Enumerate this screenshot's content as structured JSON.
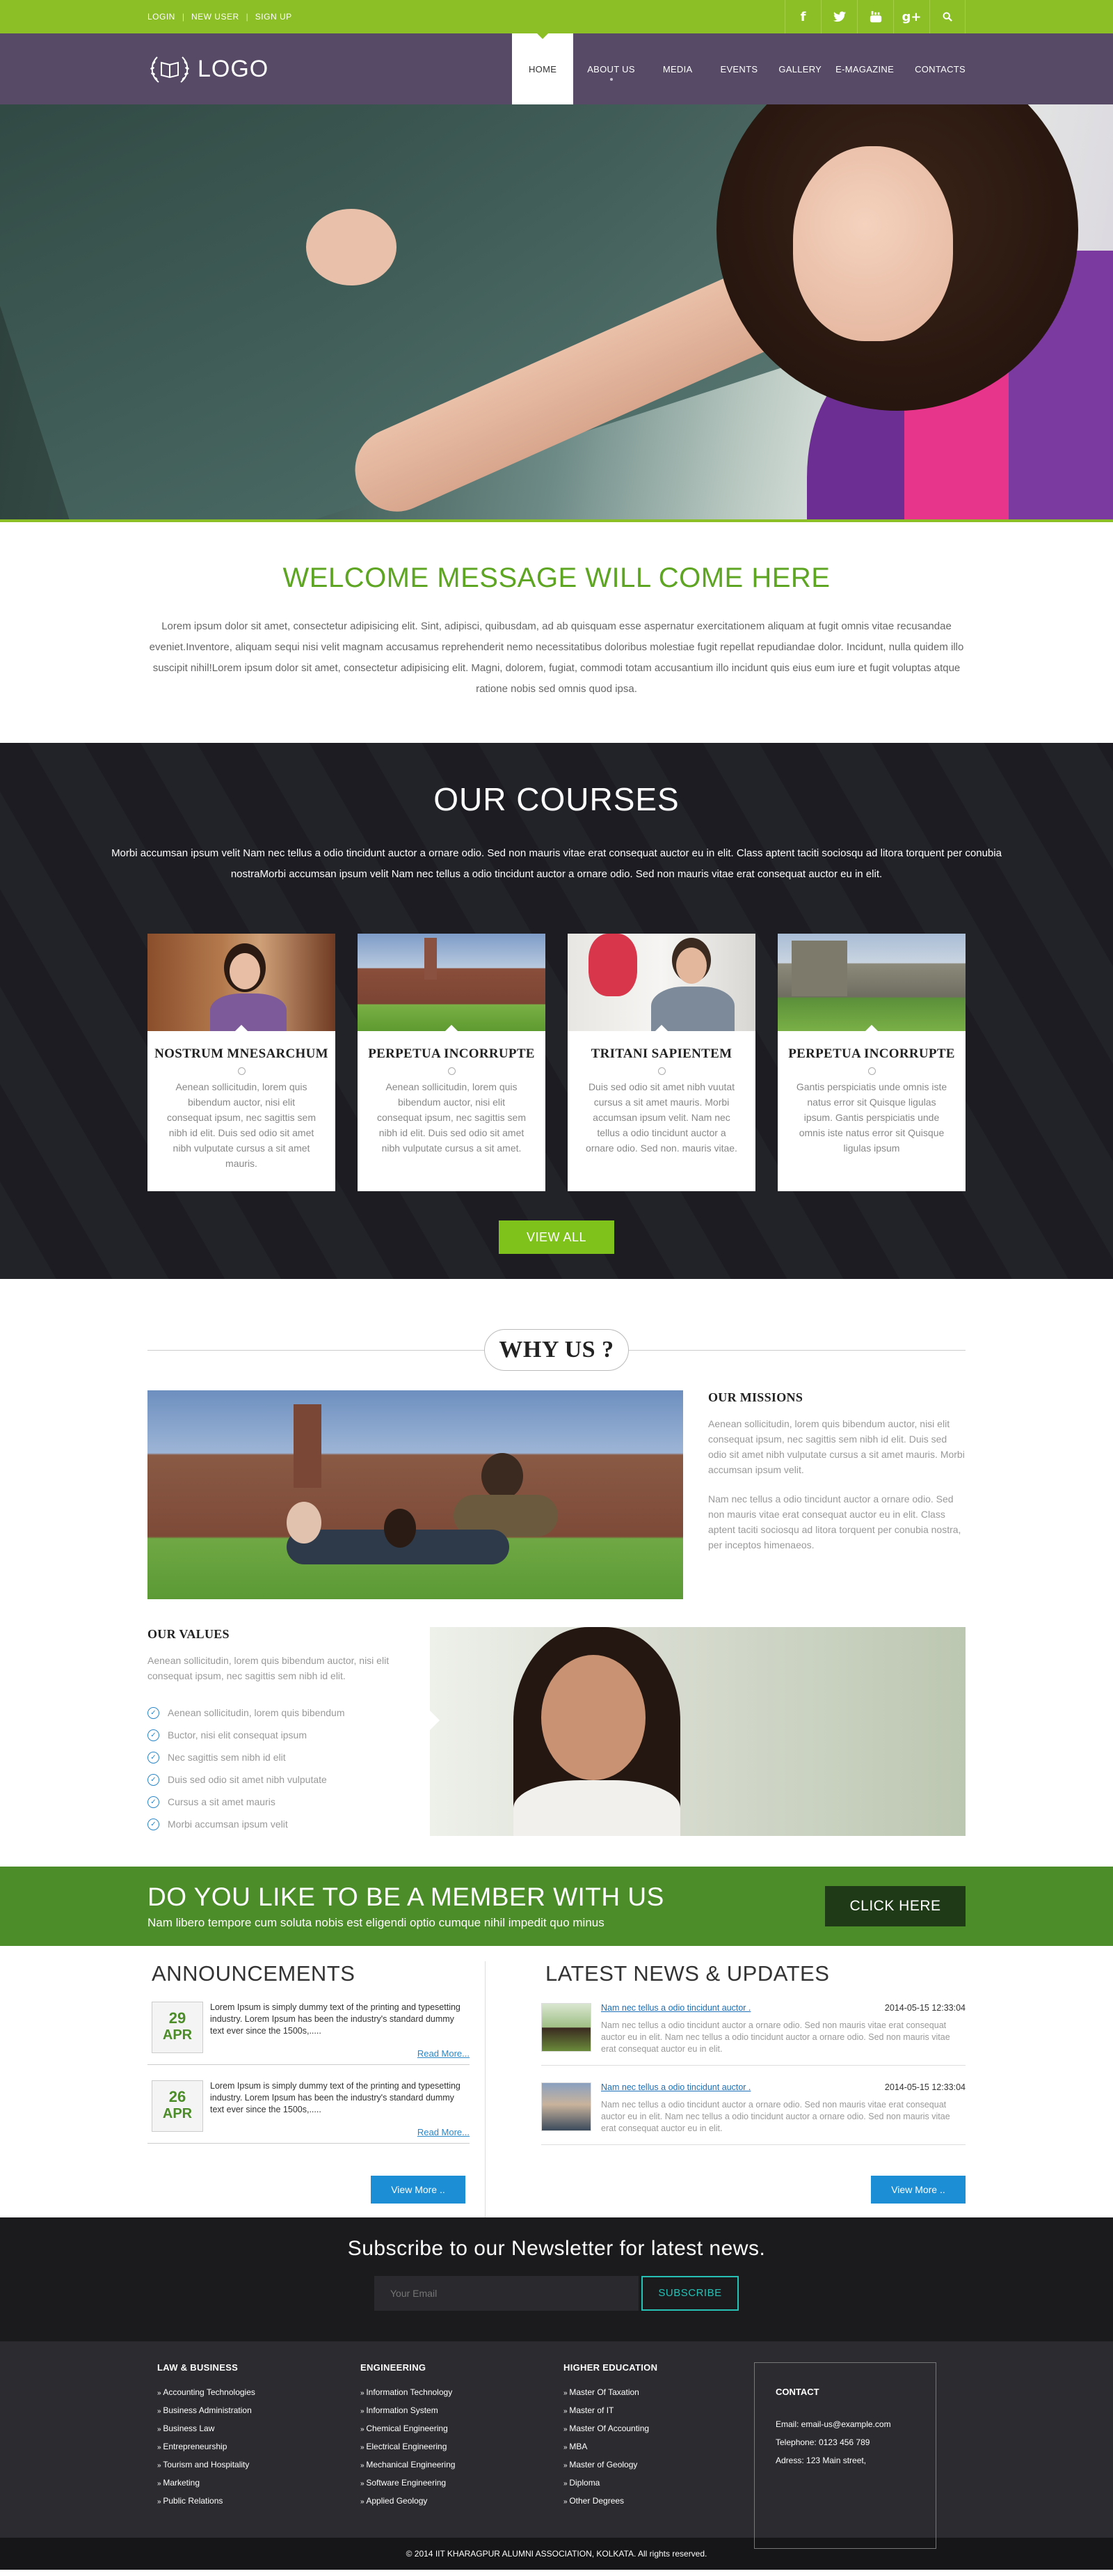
{
  "topbar": {
    "links": [
      "LOGIN",
      "NEW USER",
      "SIGN UP"
    ],
    "social_icons": [
      "facebook-icon",
      "twitter-icon",
      "youtube-icon",
      "google-plus-icon",
      "search-icon"
    ]
  },
  "nav": {
    "logo_text": "LOGO",
    "items": [
      "HOME",
      "ABOUT US",
      "MEDIA",
      "EVENTS",
      "GALLERY",
      "E-MAGAZINE",
      "CONTACTS"
    ],
    "active": "HOME"
  },
  "welcome": {
    "title": "WELCOME MESSAGE WILL COME HERE",
    "text": "Lorem ipsum dolor sit amet, consectetur adipisicing elit. Sint, adipisci, quibusdam, ad ab quisquam esse aspernatur exercitationem aliquam at fugit omnis vitae recusandae eveniet.Inventore, aliquam sequi nisi velit magnam accusamus reprehenderit nemo necessitatibus doloribus molestiae fugit repellat repudiandae dolor. Incidunt, nulla quidem illo suscipit nihil!Lorem ipsum dolor sit amet, consectetur adipisicing elit. Magni, dolorem, fugiat, commodi totam accusantium illo incidunt quis eius eum iure et fugit voluptas atque ratione nobis sed omnis quod ipsa."
  },
  "courses": {
    "title": "OUR COURSES",
    "intro": "Morbi accumsan ipsum velit Nam nec tellus a odio tincidunt auctor a ornare odio. Sed non mauris vitae erat consequat auctor eu in elit. Class aptent taciti sociosqu ad litora torquent per conubia nostraMorbi accumsan ipsum velit Nam nec tellus a odio tincidunt auctor a ornare odio. Sed non mauris vitae erat consequat auctor eu in elit.",
    "cards": [
      {
        "title": "NOSTRUM MNESARCHUM",
        "text": "Aenean sollicitudin, lorem quis bibendum auctor, nisi elit consequat ipsum, nec sagittis sem nibh id elit. Duis sed odio sit amet nibh vulputate cursus a sit amet mauris."
      },
      {
        "title": "PERPETUA INCORRUPTE",
        "text": "Aenean sollicitudin, lorem quis bibendum auctor, nisi elit consequat ipsum, nec sagittis sem nibh id elit. Duis sed odio sit amet nibh vulputate cursus a sit amet."
      },
      {
        "title": "TRITANI SAPIENTEM",
        "text": "Duis sed odio sit amet nibh vuutat cursus a sit amet mauris. Morbi accumsan ipsum velit. Nam nec tellus a odio tincidunt auctor a ornare odio. Sed non. mauris vitae."
      },
      {
        "title": "PERPETUA INCORRUPTE",
        "text": "Gantis perspiciatis unde omnis iste natus error sit Quisque ligulas ipsum. Gantis perspiciatis unde omnis iste natus error sit Quisque ligulas ipsum"
      }
    ],
    "button": "VIEW ALL"
  },
  "whyus": {
    "title": "WHY US ?",
    "mission_title": "OUR MISSIONS",
    "mission_p1": "Aenean sollicitudin, lorem quis bibendum auctor, nisi elit consequat ipsum, nec sagittis sem nibh id elit. Duis sed odio sit amet nibh vulputate cursus a sit amet mauris. Morbi accumsan ipsum velit.",
    "mission_p2": "Nam nec tellus a odio tincidunt auctor a ornare odio. Sed non mauris vitae erat consequat auctor eu in elit. Class aptent taciti sociosqu ad litora torquent per conubia nostra, per inceptos himenaeos.",
    "values_title": "OUR VALUES",
    "values_text": "Aenean sollicitudin, lorem quis bibendum auctor, nisi elit consequat ipsum, nec sagittis sem nibh id elit.",
    "values_list": [
      "Aenean sollicitudin, lorem quis bibendum",
      "Buctor, nisi elit consequat ipsum",
      "Nec sagittis sem nibh id elit",
      "Duis sed odio sit amet nibh vulputate",
      "Cursus a sit amet mauris",
      "Morbi accumsan ipsum velit"
    ]
  },
  "member": {
    "title": "DO YOU LIKE TO BE A MEMBER WITH US",
    "subtitle": "Nam libero tempore cum soluta nobis est eligendi optio cumque nihil impedit quo minus",
    "button": "CLICK HERE"
  },
  "announcements": {
    "title": "ANNOUNCEMENTS",
    "items": [
      {
        "day": "29",
        "month": "APR",
        "text": "Lorem Ipsum is simply dummy text of the printing and typesetting industry. Lorem Ipsum has been the industry's standard dummy text ever since the 1500s,.....",
        "more": "Read More..."
      },
      {
        "day": "26",
        "month": "APR",
        "text": "Lorem Ipsum is simply dummy text of the printing and typesetting industry. Lorem Ipsum has been the industry's standard dummy text ever since the 1500s,.....",
        "more": "Read More..."
      }
    ],
    "button": "View More .."
  },
  "news": {
    "title": "LATEST NEWS & UPDATES",
    "items": [
      {
        "title": "Nam nec tellus a odio tincidunt auctor .",
        "date": "2014-05-15 12:33:04",
        "text": "Nam nec tellus a odio tincidunt auctor a ornare odio. Sed non mauris vitae erat consequat auctor eu in elit. Nam nec tellus a odio tincidunt auctor a ornare odio. Sed non mauris vitae erat consequat auctor eu in elit."
      },
      {
        "title": "Nam nec tellus a odio tincidunt auctor .",
        "date": "2014-05-15 12:33:04",
        "text": "Nam nec tellus a odio tincidunt auctor a ornare odio. Sed non mauris vitae erat consequat auctor eu in elit. Nam nec tellus a odio tincidunt auctor a ornare odio. Sed non mauris vitae erat consequat auctor eu in elit."
      }
    ],
    "button": "View More .."
  },
  "newsletter": {
    "title": "Subscribe to our Newsletter for latest news.",
    "placeholder": "Your Email",
    "button": "SUBSCRIBE"
  },
  "footer": {
    "columns": [
      {
        "title": "LAW & BUSINESS",
        "links": [
          "Accounting Technologies",
          "Business Administration",
          "Business Law",
          "Entrepreneurship",
          "Tourism and Hospitality",
          "Marketing",
          "Public Relations"
        ]
      },
      {
        "title": "ENGINEERING",
        "links": [
          "Information Technology",
          "Information System",
          "Chemical Engineering",
          "Electrical Engineering",
          "Mechanical Engineering",
          "Software Engineering",
          "Applied Geology"
        ]
      },
      {
        "title": "HIGHER EDUCATION",
        "links": [
          "Master Of Taxation",
          "Master of IT",
          "Master Of Accounting",
          "MBA",
          "Master of Geology",
          "Diploma",
          "Other Degrees"
        ]
      }
    ],
    "contact": {
      "title": "CONTACT",
      "email": "Email: email-us@example.com",
      "phone": "Telephone: 0123 456 789",
      "address": "Adress: 123 Main street,"
    },
    "copyright": "© 2014 IIT KHARAGPUR ALUMNI ASSOCIATION, KOLKATA. All rights reserved."
  },
  "colors": {
    "accent_green": "#8cbf26",
    "nav_purple": "#564a66",
    "member_green": "#4c8c29",
    "link_blue": "#1b8ed6"
  }
}
